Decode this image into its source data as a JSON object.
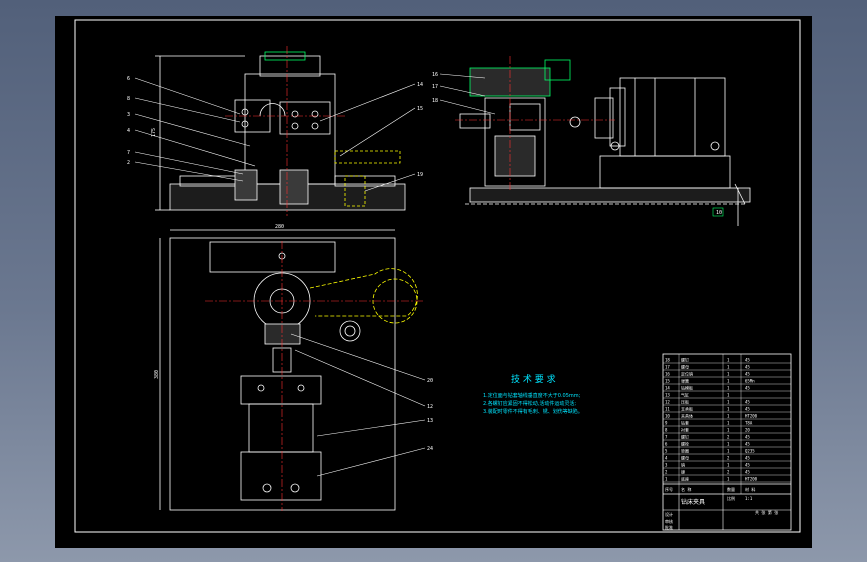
{
  "sheet": {
    "background": "#000000",
    "frame_color": "#ffffff",
    "note_color": "#00e5ff",
    "centerline_color": "#ff3030",
    "hidden_color": "#ffff00",
    "section_color": "#00ff66"
  },
  "notes": {
    "title": "技 术 要 求",
    "lines": [
      "1.定位面与钻套轴线垂直度不大于0.05mm;",
      "2.各螺钉应紧固不得松动,活动件运动灵活;",
      "3.装配时零件不得有毛刺、锈、划伤等缺陷。"
    ]
  },
  "balloons": {
    "front_view": [
      "6",
      "8",
      "3",
      "4",
      "7",
      "2",
      "14",
      "15",
      "19"
    ],
    "side_view": [
      "16",
      "17",
      "18"
    ],
    "top_view": [
      "20",
      "12",
      "13",
      "24"
    ],
    "side_view_bottom": "10"
  },
  "dimensions": {
    "front_height": "175",
    "top_width": "280",
    "top_height": "380"
  },
  "bom": {
    "rows": [
      [
        "18",
        "螺钉",
        "1",
        "45"
      ],
      [
        "17",
        "螺母",
        "1",
        "45"
      ],
      [
        "16",
        "定位销",
        "1",
        "45"
      ],
      [
        "15",
        "弹簧",
        "1",
        "65Mn"
      ],
      [
        "14",
        "钻模板",
        "1",
        "45"
      ],
      [
        "13",
        "气缸",
        "1",
        ""
      ],
      [
        "12",
        "压板",
        "1",
        "45"
      ],
      [
        "11",
        "支承板",
        "1",
        "45"
      ],
      [
        "10",
        "夹具体",
        "1",
        "HT200"
      ],
      [
        "9",
        "钻套",
        "1",
        "T8A"
      ],
      [
        "8",
        "衬套",
        "1",
        "20"
      ],
      [
        "7",
        "螺钉",
        "2",
        "45"
      ],
      [
        "6",
        "螺栓",
        "1",
        "45"
      ],
      [
        "5",
        "垫圈",
        "1",
        "Q235"
      ],
      [
        "4",
        "螺母",
        "2",
        "45"
      ],
      [
        "3",
        "销",
        "1",
        "45"
      ],
      [
        "2",
        "键",
        "2",
        "45"
      ],
      [
        "1",
        "底座",
        "1",
        "HT200"
      ]
    ],
    "header": [
      "序号",
      "名 称",
      "数量",
      "材 料"
    ],
    "title_block": {
      "drawing_name": "钻床夹具",
      "scale_label": "比例",
      "scale_value": "1:1",
      "sheet_label": "共 张 第 张",
      "designer_label": "设计",
      "checker_label": "审核",
      "approver_label": "批准"
    }
  }
}
